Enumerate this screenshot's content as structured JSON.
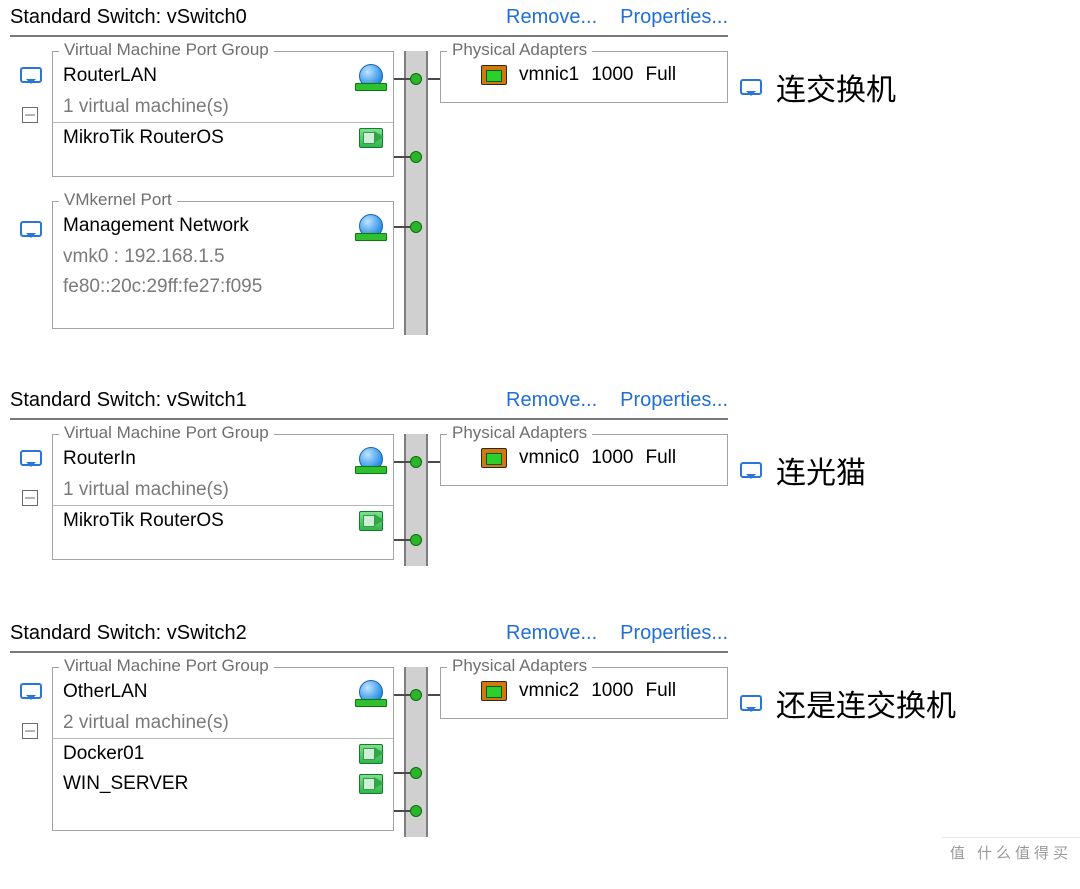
{
  "switches": [
    {
      "title": "Standard Switch: vSwitch0",
      "remove": "Remove...",
      "properties": "Properties...",
      "pg_legend": "Virtual Machine Port Group",
      "pg_name": "RouterLAN",
      "vm_count": "1 virtual machine(s)",
      "vms": [
        "MikroTik RouterOS"
      ],
      "vmk_legend": "VMkernel Port",
      "vmk_name": "Management Network",
      "vmk_addr1": "vmk0 : 192.168.1.5",
      "vmk_addr2": "fe80::20c:29ff:fe27:f095",
      "phys_legend": "Physical Adapters",
      "phys_name": "vmnic1",
      "phys_speed": "1000",
      "phys_duplex": "Full",
      "annotation": "连交换机"
    },
    {
      "title": "Standard Switch: vSwitch1",
      "remove": "Remove...",
      "properties": "Properties...",
      "pg_legend": "Virtual Machine Port Group",
      "pg_name": "RouterIn",
      "vm_count": "1 virtual machine(s)",
      "vms": [
        "MikroTik RouterOS"
      ],
      "phys_legend": "Physical Adapters",
      "phys_name": "vmnic0",
      "phys_speed": "1000",
      "phys_duplex": "Full",
      "annotation": "连光猫"
    },
    {
      "title": "Standard Switch: vSwitch2",
      "remove": "Remove...",
      "properties": "Properties...",
      "pg_legend": "Virtual Machine Port Group",
      "pg_name": "OtherLAN",
      "vm_count": "2 virtual machine(s)",
      "vms": [
        "Docker01",
        "WIN_SERVER"
      ],
      "phys_legend": "Physical Adapters",
      "phys_name": "vmnic2",
      "phys_speed": "1000",
      "phys_duplex": "Full",
      "annotation": "还是连交换机"
    }
  ],
  "watermark": "值 什么值得买"
}
